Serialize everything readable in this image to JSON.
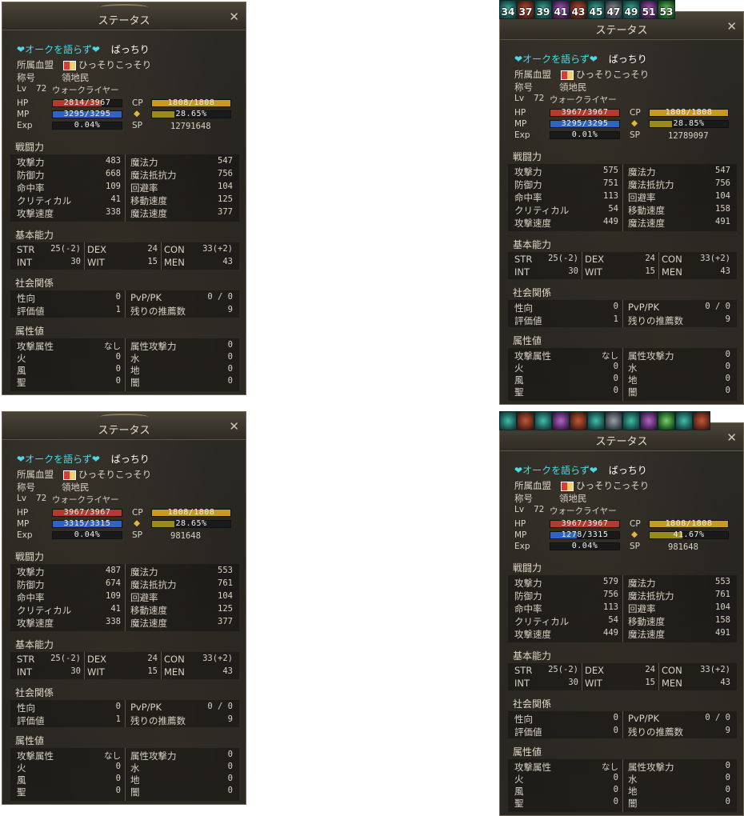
{
  "colors": {
    "hp": "#b23a2e",
    "mp": "#2f63c6",
    "cp": "#c79a22",
    "weight": "#9a8a1a",
    "exp": "#3a3a3a",
    "text": "#d8d2c4",
    "heart": "#4fd8e8"
  },
  "shared": {
    "window_title": "ステータス",
    "close_glyph": "✕",
    "heart_left": "❤",
    "heart_right": "❤",
    "name_prefix": "オークを語らず",
    "char_name": "ばっちり",
    "clan_label": "所属血盟",
    "clan_name": "ひっそりこっそり",
    "title_label": "称号",
    "title_value": "領地民",
    "lv_label": "Lv",
    "level": "72",
    "class": "ウォークライヤー",
    "hp_label": "HP",
    "mp_label": "MP",
    "exp_label": "Exp",
    "cp_label": "CP",
    "sp_label": "SP",
    "sec_combat": "戦闘力",
    "sec_basic": "基本能力",
    "sec_social": "社会関係",
    "sec_attr": "属性値",
    "k_patk": "攻撃力",
    "k_matk": "魔法力",
    "k_pdef": "防御力",
    "k_mdef": "魔法抵抗力",
    "k_acc": "命中率",
    "k_eva": "回避率",
    "k_crit": "クリティカル",
    "k_move": "移動速度",
    "k_atkspd": "攻撃速度",
    "k_cast": "魔法速度",
    "k_str": "STR",
    "k_dex": "DEX",
    "k_con": "CON",
    "k_int": "INT",
    "k_wit": "WIT",
    "k_men": "MEN",
    "k_karma": "性向",
    "k_pvp": "PvP/PK",
    "k_fame": "評価値",
    "k_rec": "残りの推薦数",
    "k_atkattr": "攻撃属性",
    "k_attrpow": "属性攻撃力",
    "k_fire": "火",
    "k_water": "水",
    "k_wind": "風",
    "k_earth": "地",
    "k_holy": "聖",
    "k_dark": "闇",
    "str": "25(-2)",
    "dex": "24",
    "con": "33(+2)",
    "int": "30",
    "wit": "15",
    "men": "43",
    "karma": "0",
    "pvp": "0 / 0",
    "rec": "9",
    "atkattr": "なし",
    "attrpow": "0",
    "fire": "0",
    "water": "0",
    "wind": "0",
    "earth": "0",
    "holy": "0",
    "dark": "0"
  },
  "panels": [
    {
      "hp": "2814/3967",
      "hp_frac": 0.709,
      "mp": "3295/3295",
      "mp_frac": 1.0,
      "exp": "0.04%",
      "exp_frac": 0.0004,
      "cp": "1808/1808",
      "cp_frac": 1.0,
      "weight": "28.65%",
      "weight_frac": 0.2865,
      "sp": "12791648",
      "patk": "483",
      "matk": "547",
      "pdef": "668",
      "mdef": "756",
      "acc": "109",
      "eva": "104",
      "crit": "41",
      "move": "125",
      "atkspd": "338",
      "cast": "377",
      "fame": "1"
    },
    {
      "hp": "3967/3967",
      "hp_frac": 1.0,
      "mp": "3295/3295",
      "mp_frac": 1.0,
      "exp": "0.01%",
      "exp_frac": 0.0001,
      "cp": "1808/1808",
      "cp_frac": 1.0,
      "weight": "28.85%",
      "weight_frac": 0.2885,
      "sp": "12789097",
      "patk": "575",
      "matk": "547",
      "pdef": "751",
      "mdef": "756",
      "acc": "113",
      "eva": "104",
      "crit": "54",
      "move": "158",
      "atkspd": "449",
      "cast": "491",
      "fame": "1"
    },
    {
      "hp": "3967/3967",
      "hp_frac": 1.0,
      "mp": "3315/3315",
      "mp_frac": 1.0,
      "exp": "0.04%",
      "exp_frac": 0.0004,
      "cp": "1808/1808",
      "cp_frac": 1.0,
      "weight": "28.65%",
      "weight_frac": 0.2865,
      "sp": "981648",
      "patk": "487",
      "matk": "553",
      "pdef": "674",
      "mdef": "761",
      "acc": "109",
      "eva": "104",
      "crit": "41",
      "move": "125",
      "atkspd": "338",
      "cast": "377",
      "fame": "1"
    },
    {
      "hp": "3967/3967",
      "hp_frac": 1.0,
      "mp": "1278/3315",
      "mp_frac": 0.3855,
      "exp": "0.04%",
      "exp_frac": 0.0004,
      "cp": "1808/1808",
      "cp_frac": 1.0,
      "weight": "41.67%",
      "weight_frac": 0.4167,
      "sp": "981648",
      "patk": "579",
      "matk": "553",
      "pdef": "756",
      "mdef": "761",
      "acc": "113",
      "eva": "104",
      "crit": "54",
      "move": "158",
      "atkspd": "449",
      "cast": "491",
      "fame": "0"
    }
  ],
  "buff_timers": [
    "34",
    "37",
    "39",
    "41",
    "43",
    "45",
    "47",
    "49",
    "51",
    "53"
  ]
}
